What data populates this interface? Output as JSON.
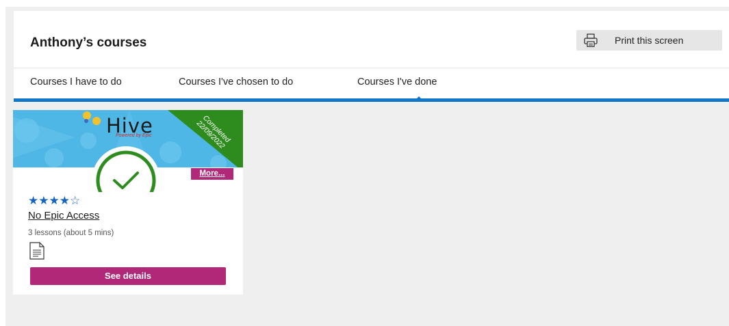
{
  "header": {
    "title": "Anthony’s courses",
    "print_label": "Print this screen"
  },
  "tabs": [
    {
      "label": "Courses I have to do"
    },
    {
      "label": "Courses I've chosen to do"
    },
    {
      "label": "Courses I've done",
      "active": true
    }
  ],
  "course": {
    "logo": "Hive",
    "logo_sub": "Powered by Epic",
    "completed_label": "Completed",
    "completed_date": "22/09/2022",
    "more_label": "More...",
    "rating": 4,
    "rating_max": 5,
    "stars": "★★★★☆",
    "title": "No Epic Access",
    "lessons": "3 lessons (about 5 mins)",
    "details_label": "See details",
    "doc_icon": "document-icon"
  },
  "colors": {
    "accent_blue": "#1176c7",
    "button_magenta": "#b12878",
    "ribbon_green": "#2e8b1e",
    "check_green": "#2e8b1e",
    "banner_blue": "#4fb7e6",
    "star_blue": "#1565c0"
  }
}
